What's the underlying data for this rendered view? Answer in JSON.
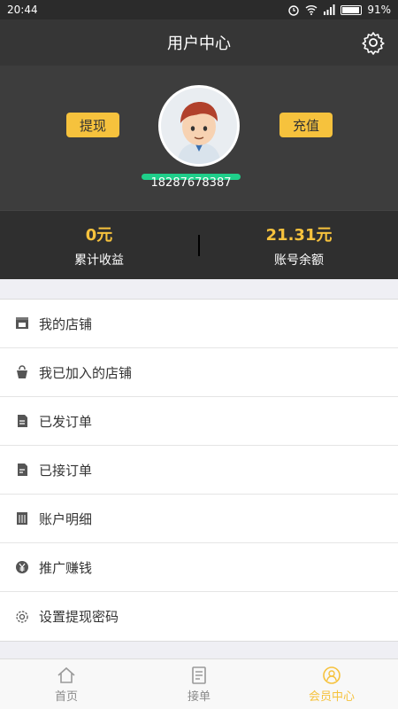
{
  "status": {
    "time": "20:44",
    "battery": "91%"
  },
  "header": {
    "title": "用户中心"
  },
  "hero": {
    "withdraw": "提现",
    "recharge": "充值",
    "phone": "18287678387"
  },
  "stats": [
    {
      "value": "0元",
      "label": "累计收益"
    },
    {
      "value": "21.31元",
      "label": "账号余额"
    }
  ],
  "menu": [
    {
      "label": "我的店铺",
      "icon": "store-icon"
    },
    {
      "label": "我已加入的店铺",
      "icon": "bag-icon"
    },
    {
      "label": "已发订单",
      "icon": "sent-order-icon"
    },
    {
      "label": "已接订单",
      "icon": "received-order-icon"
    },
    {
      "label": "账户明细",
      "icon": "ledger-icon"
    },
    {
      "label": "推广赚钱",
      "icon": "yen-icon"
    },
    {
      "label": "设置提现密码",
      "icon": "gear-icon"
    }
  ],
  "nav": [
    {
      "label": "首页"
    },
    {
      "label": "接单"
    },
    {
      "label": "会员中心"
    }
  ],
  "colors": {
    "accent": "#f6c23d",
    "dark": "#363636"
  }
}
